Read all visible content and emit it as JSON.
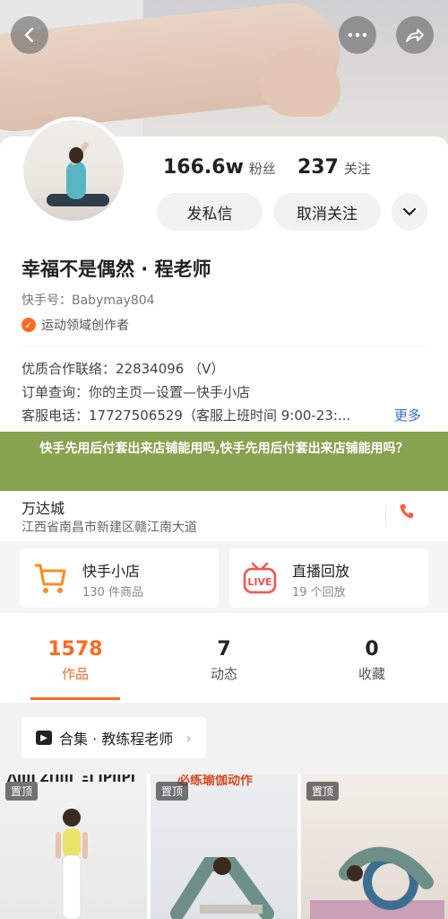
{
  "nav": {
    "back_icon": "back-icon",
    "more_icon": "more-icon",
    "share_icon": "share-icon"
  },
  "stats": {
    "fans_value": "166.6w",
    "fans_label": "粉丝",
    "follow_value": "237",
    "follow_label": "关注"
  },
  "actions": {
    "message": "发私信",
    "unfollow": "取消关注"
  },
  "profile": {
    "name": "幸福不是偶然 · 程老师",
    "kid": "快手号：Babymay804",
    "badge": "运动领域创作者"
  },
  "info": {
    "line1": "优质合作联络：22834096 （V）",
    "line2": "订单查询：你的主页—设置—快手小店",
    "line3": "客服电话：17727506529（客服上班时间 9:00-23:...",
    "more": "更多"
  },
  "banner": "快手先用后付套出来店铺能用吗,快手先用后付套出来店铺能用吗？",
  "address": {
    "title": "万达城",
    "line": "江西省南昌市新建区赣江南大道"
  },
  "cards": [
    {
      "title": "快手小店",
      "sub": "130 件商品"
    },
    {
      "title": "直播回放",
      "sub": "19 个回放"
    }
  ],
  "tabs": [
    {
      "num": "1578",
      "label": "作品"
    },
    {
      "num": "7",
      "label": "动态"
    },
    {
      "num": "0",
      "label": "收藏"
    }
  ],
  "collection": {
    "label": "合集 · 教练程老师"
  },
  "thumbs": [
    {
      "pin": "置顶",
      "caption": "ΛΙΙΙΙ ΖΠΙΙΓ ΞΙ ΙΡΙΙΡΙ"
    },
    {
      "pin": "置顶",
      "caption": "必练瑜伽动作"
    },
    {
      "pin": "置顶",
      "caption": ""
    }
  ],
  "colors": {
    "accent": "#ff6a1f",
    "banner": "#86a34f",
    "link": "#2f6fd6"
  }
}
